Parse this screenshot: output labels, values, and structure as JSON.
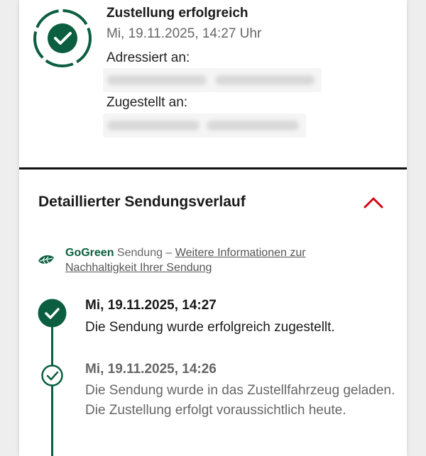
{
  "status": {
    "icon": "check-circle-icon",
    "title": "Zustellung erfolgreich",
    "datetime": "Mi, 19.11.2025, 14:27 Uhr",
    "addressed_label": "Adressiert an:",
    "delivered_label": "Zugestellt an:"
  },
  "history": {
    "title": "Detaillierter Sendungsverlauf",
    "toggle_icon": "chevron-up-icon",
    "gogreen": {
      "icon": "leaf-icon",
      "brand": "GoGreen",
      "text": "Sendung –",
      "link": "Weitere Informationen zur Nachhaltigkeit Ihrer Sendung"
    },
    "events": [
      {
        "date": "Mi, 19.11.2025, 14:27",
        "text": "Die Sendung wurde erfolgreich zugestellt."
      },
      {
        "date": "Mi, 19.11.2025, 14:26",
        "text": "Die Sendung wurde in das Zustellfahrzeug geladen. Die Zustellung erfolgt voraussichtlich heute."
      }
    ]
  },
  "colors": {
    "accent_green": "#0b5e3f",
    "toggle_red": "#d40511"
  }
}
